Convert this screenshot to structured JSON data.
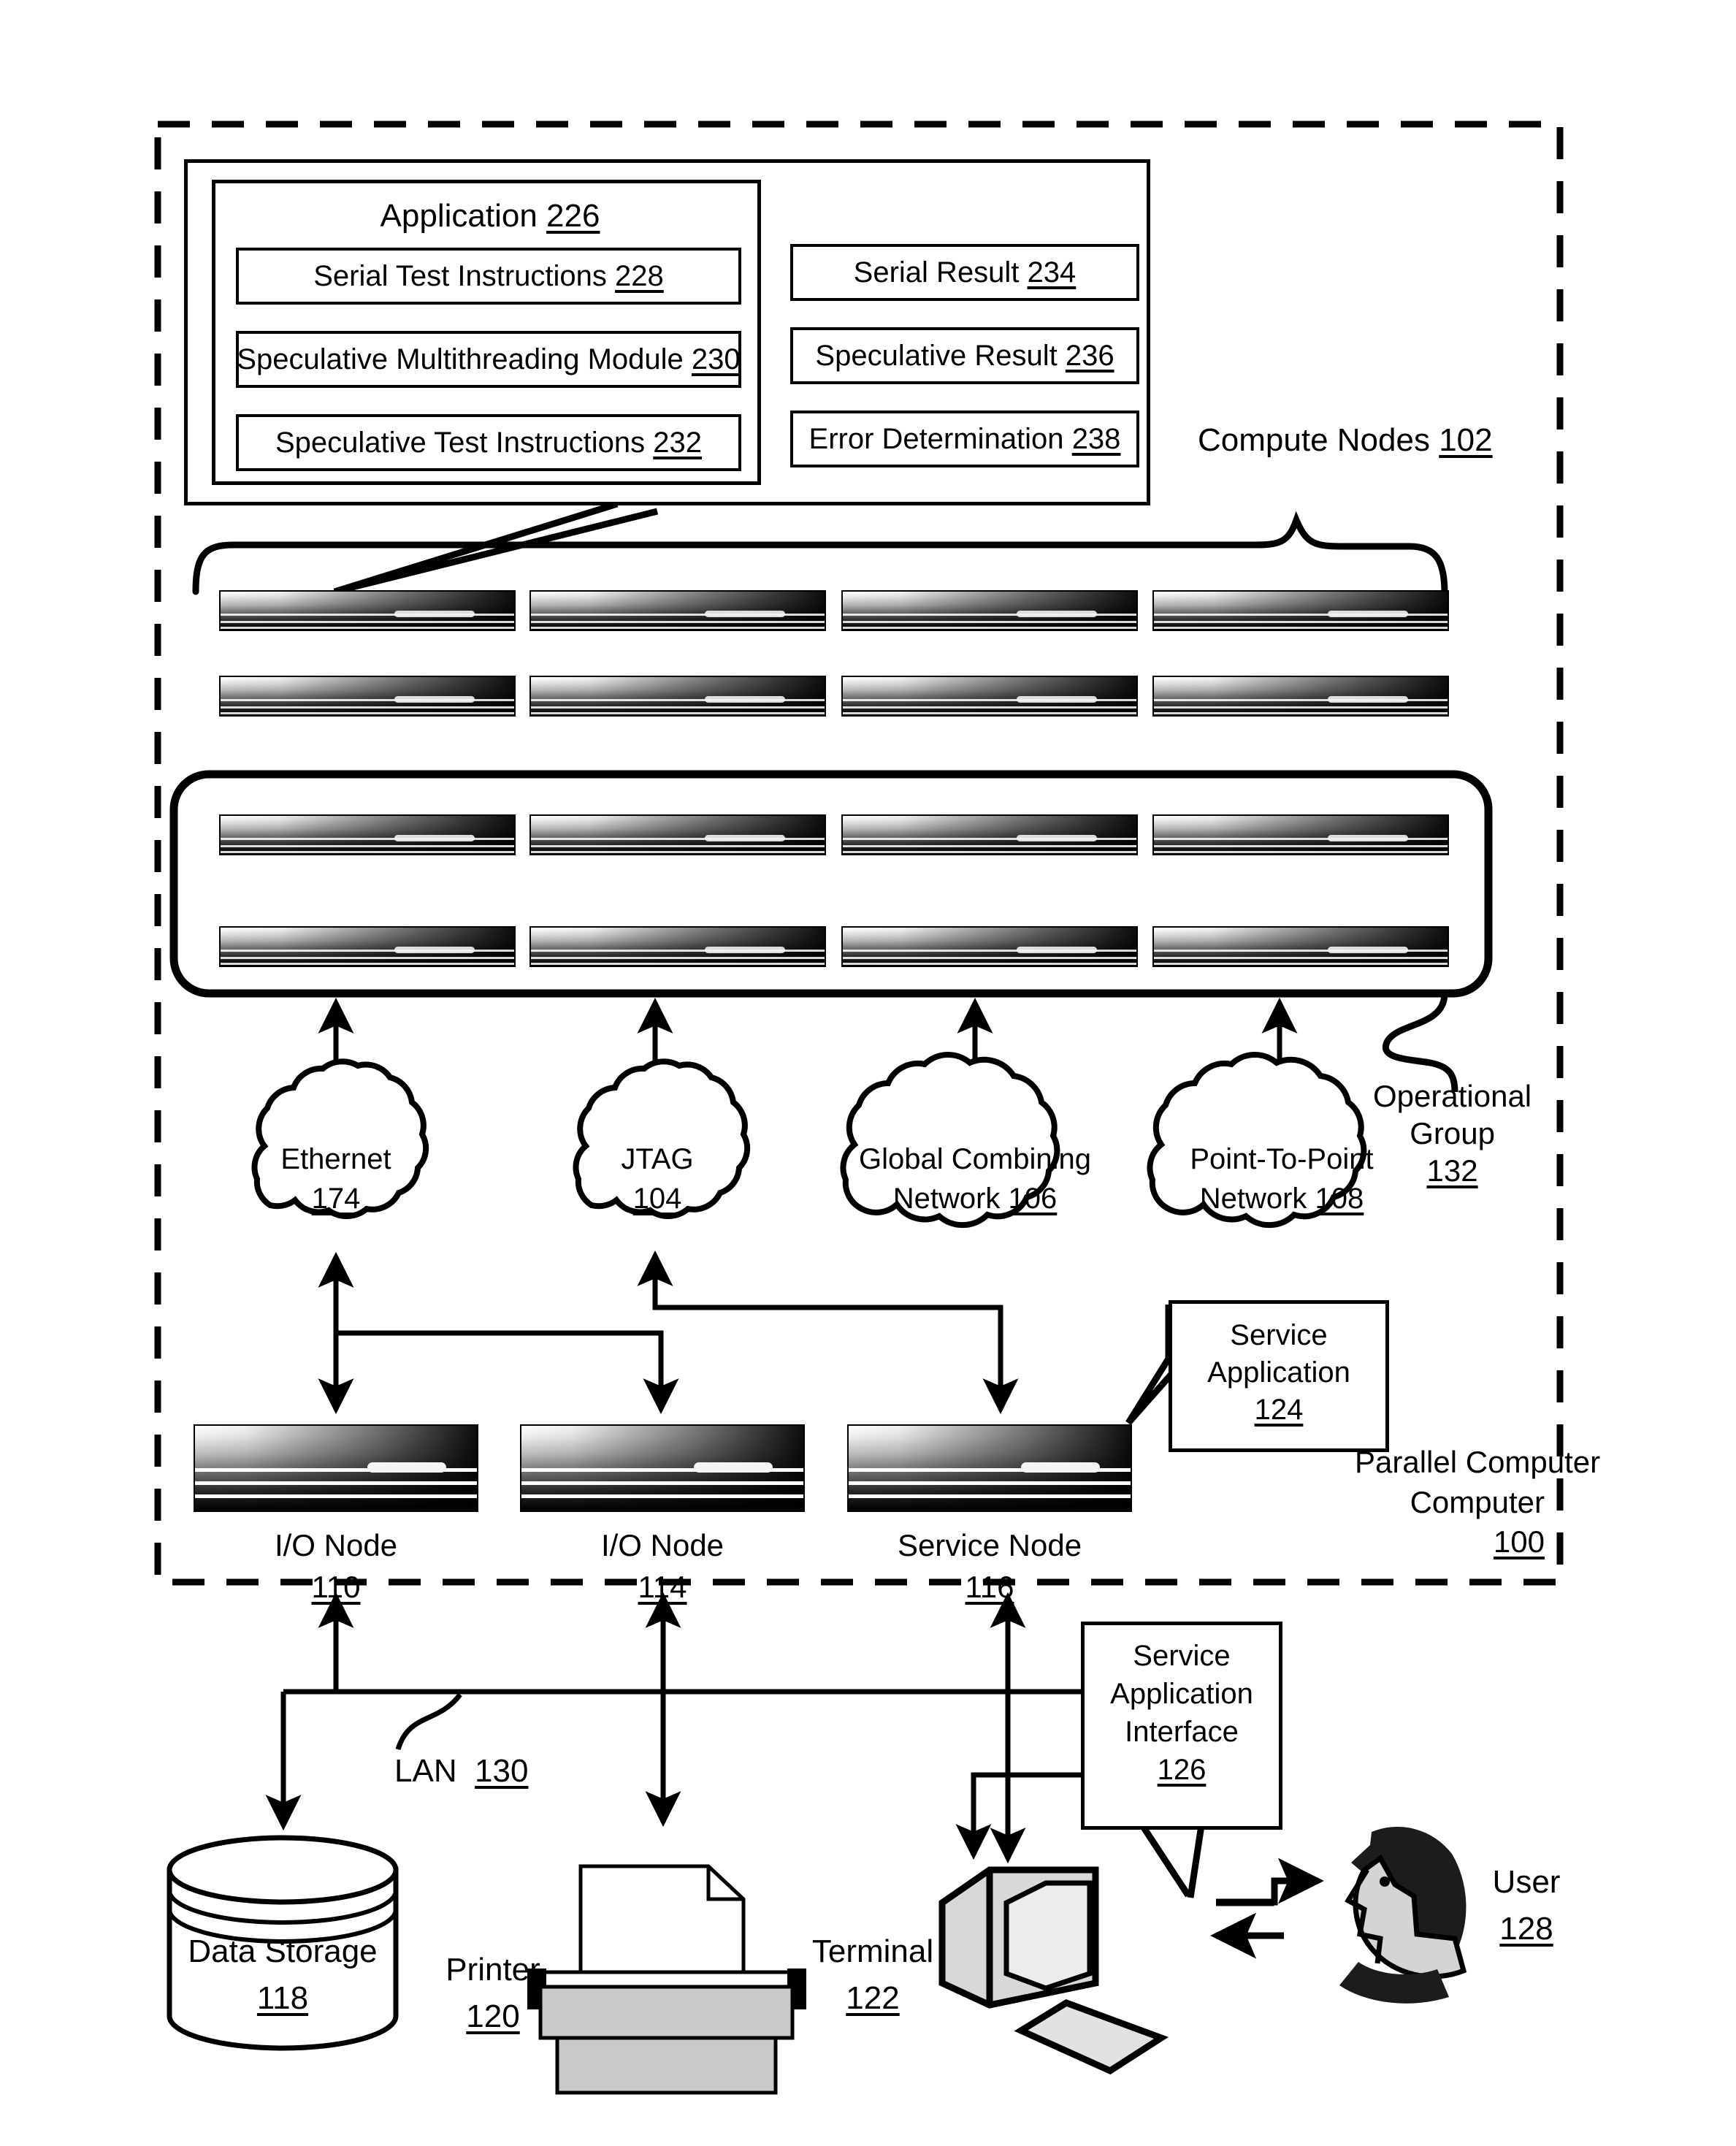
{
  "figure": {
    "parallel_computer": {
      "label": "Parallel Computer",
      "ref": "100"
    },
    "compute_nodes": {
      "label": "Compute Nodes",
      "ref": "102"
    },
    "operational_group": {
      "label": "Operational",
      "label2": "Group",
      "ref": "132"
    },
    "lan": {
      "label": "LAN",
      "ref": "130"
    }
  },
  "application": {
    "title": "Application",
    "title_ref": "226",
    "left_items": [
      {
        "label": "Serial Test Instructions",
        "ref": "228"
      },
      {
        "label": "Speculative Multithreading Module",
        "ref": "230"
      },
      {
        "label": "Speculative Test Instructions",
        "ref": "232"
      }
    ],
    "right_items": [
      {
        "label": "Serial Result",
        "ref": "234"
      },
      {
        "label": "Speculative Result",
        "ref": "236"
      },
      {
        "label": "Error Determination",
        "ref": "238"
      }
    ]
  },
  "networks": [
    {
      "name": "network-ethernet",
      "line1": "Ethernet",
      "line2": "",
      "ref": "174"
    },
    {
      "name": "network-jtag",
      "line1": "JTAG",
      "line2": "",
      "ref": "104"
    },
    {
      "name": "network-global-combining",
      "line1": "Global Combining",
      "line2": "Network",
      "ref": "106"
    },
    {
      "name": "network-point-to-point",
      "line1": "Point-To-Point",
      "line2": "Network",
      "ref": "108"
    }
  ],
  "service_nodes": [
    {
      "name": "io-node-110",
      "label": "I/O Node",
      "ref": "110"
    },
    {
      "name": "io-node-114",
      "label": "I/O Node",
      "ref": "114"
    },
    {
      "name": "service-node-116",
      "label": "Service Node",
      "ref": "116"
    }
  ],
  "callouts": {
    "service_application": {
      "line1": "Service",
      "line2": "Application",
      "ref": "124"
    },
    "service_application_interface": {
      "line1": "Service",
      "line2": "Application",
      "line3": "Interface",
      "ref": "126"
    }
  },
  "peripherals": {
    "data_storage": {
      "label": "Data Storage",
      "ref": "118"
    },
    "printer": {
      "label": "Printer",
      "ref": "120"
    },
    "terminal": {
      "label": "Terminal",
      "ref": "122"
    },
    "user": {
      "label": "User",
      "ref": "128"
    }
  },
  "colors": {
    "ink": "#000000",
    "paper": "#ffffff"
  }
}
